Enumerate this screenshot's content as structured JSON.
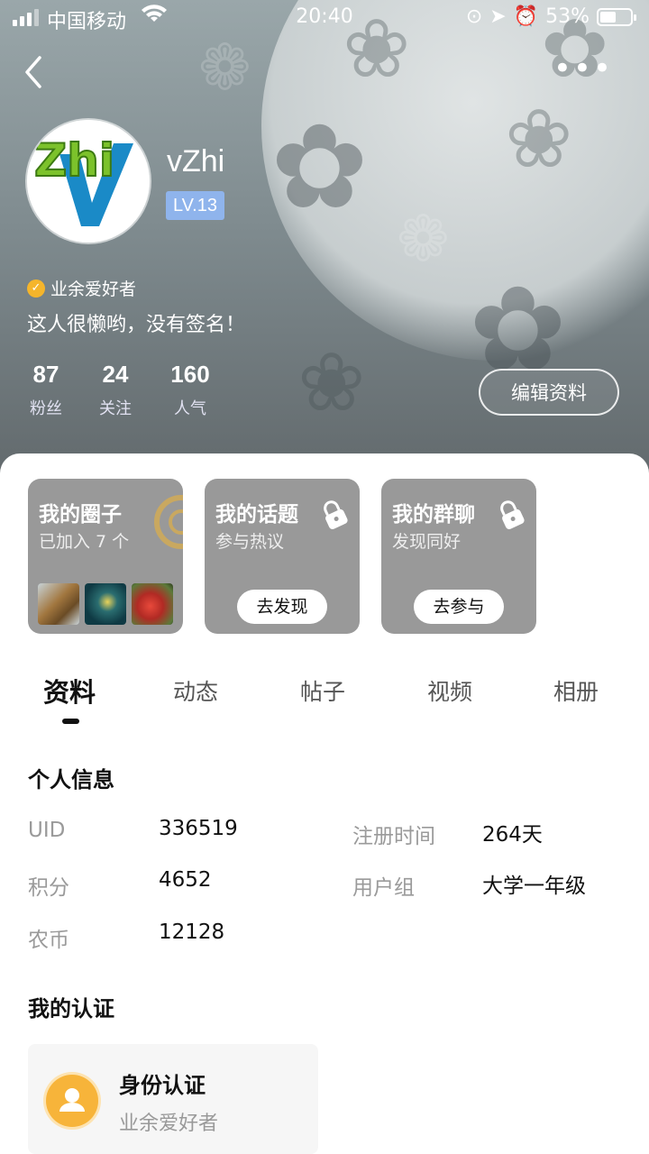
{
  "status_bar": {
    "carrier": "中国移动",
    "time": "20:40",
    "battery": "53%",
    "battery_level": 0.53
  },
  "profile": {
    "avatar_text": "Zhi",
    "username": "vZhi",
    "level": "LV.13",
    "title": "业余爱好者",
    "bio": "这人很懒哟，没有签名！",
    "stats": [
      {
        "num": "87",
        "label": "粉丝"
      },
      {
        "num": "24",
        "label": "关注"
      },
      {
        "num": "160",
        "label": "人气"
      }
    ],
    "edit_button": "编辑资料"
  },
  "cards": [
    {
      "title": "我的圈子",
      "subtitle": "已加入 7 个"
    },
    {
      "title": "我的话题",
      "subtitle": "参与热议",
      "action": "去发现"
    },
    {
      "title": "我的群聊",
      "subtitle": "发现同好",
      "action": "去参与"
    }
  ],
  "tabs": [
    "资料",
    "动态",
    "帖子",
    "视频",
    "相册"
  ],
  "personal_info": {
    "heading": "个人信息",
    "rows": [
      {
        "key": "UID",
        "value": "336519"
      },
      {
        "key": "积分",
        "value": "4652"
      },
      {
        "key": "农币",
        "value": "12128"
      },
      {
        "key": "注册时间",
        "value": "264天"
      },
      {
        "key": "用户组",
        "value": "大学一年级"
      }
    ]
  },
  "certification": {
    "heading": "我的认证",
    "title": "身份认证",
    "subtitle": "业余爱好者"
  },
  "colors": {
    "level_badge": "#8fb4ec",
    "cert_icon": "#f7b43a",
    "card_bg": "#999999"
  }
}
